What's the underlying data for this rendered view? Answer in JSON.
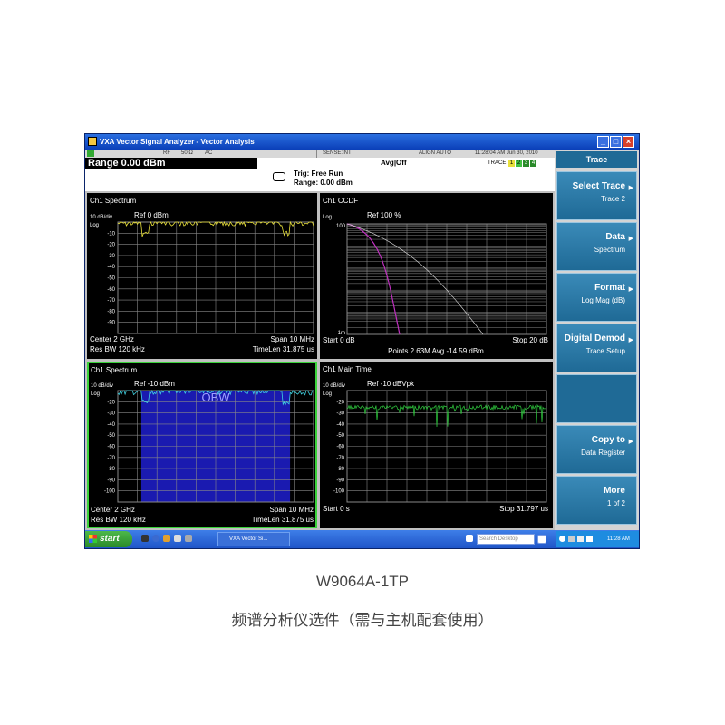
{
  "window": {
    "title": "VXA Vector Signal Analyzer - Vector Analysis",
    "controls": [
      "_",
      "□",
      "×"
    ]
  },
  "statusbar": {
    "items": [
      "RF",
      "50 Ω",
      "AC",
      "SENSE:INT",
      "ALIGN AUTO"
    ],
    "timestamp": "11:28:04 AM Jun 30, 2010",
    "trace_label": "TRACE",
    "trace_numbers": [
      "1",
      "2",
      "3",
      "4"
    ]
  },
  "header": {
    "range": "Range  0.00 dBm",
    "avg": "Avg|Off",
    "trig": "Trig: Free Run",
    "range2": "Range: 0.00 dBm"
  },
  "panels": [
    {
      "title": "Ch1 Spectrum",
      "scale": "10 dB/div",
      "ref": "Ref 0 dBm",
      "log": "Log",
      "yticks": [
        "-10",
        "-20",
        "-30",
        "-40",
        "-50",
        "-60",
        "-70",
        "-80",
        "-90"
      ],
      "bottom_left": "Center 2 GHz",
      "bottom_right": "Span 10 MHz",
      "bottom_left2": "Res BW 120 kHz",
      "bottom_right2": "TimeLen 31.875 us",
      "trace_color": "#e8e03a"
    },
    {
      "title": "Ch1 CCDF",
      "scale": "Log",
      "ref": "Ref 100  %",
      "yticks": [
        "100",
        "1m"
      ],
      "bottom_left": "Start 0 dB",
      "bottom_right": "Stop 20 dB",
      "bottom_center": "Points 2.63M   Avg -14.59 dBm",
      "trace_color": "#c030c0"
    },
    {
      "title": "Ch1 Spectrum",
      "scale": "10 dB/div",
      "ref": "Ref -10 dBm",
      "log": "Log",
      "overlay_label": "OBW",
      "yticks": [
        "-20",
        "-30",
        "-40",
        "-50",
        "-60",
        "-70",
        "-80",
        "-90",
        "-100"
      ],
      "bottom_left": "Center 2 GHz",
      "bottom_right": "Span 10 MHz",
      "bottom_left2": "Res BW 120 kHz",
      "bottom_right2": "TimeLen 31.875 us",
      "trace_color": "#40d0e0",
      "highlight_color": "#1a1ab0"
    },
    {
      "title": "Ch1 Main Time",
      "scale": "10 dB/div",
      "ref": "Ref -10 dBVpk",
      "log": "Log",
      "yticks": [
        "-20",
        "-30",
        "-40",
        "-50",
        "-60",
        "-70",
        "-80",
        "-90",
        "-100"
      ],
      "bottom_left": "Start 0  s",
      "bottom_right": "Stop 31.797 us",
      "trace_color": "#30d040"
    }
  ],
  "sidebar": {
    "title": "Trace",
    "keys": [
      {
        "l1": "Select Trace",
        "l2": "Trace 2",
        "arrow": "▶"
      },
      {
        "l1": "Data",
        "l2": "Spectrum",
        "arrow": "▶"
      },
      {
        "l1": "Format",
        "l2": "Log Mag (dB)",
        "arrow": "▶"
      },
      {
        "l1": "Digital Demod",
        "l2": "Trace Setup",
        "arrow": "▶"
      },
      {
        "l1": "",
        "l2": "",
        "arrow": ""
      },
      {
        "l1": "Copy to",
        "l2": "Data Register",
        "arrow": "▶"
      },
      {
        "l1": "More",
        "l2": "1 of 2",
        "arrow": ""
      }
    ]
  },
  "taskbar": {
    "start": "start",
    "task_button": "VXA Vector Si...",
    "search_placeholder": "Search Desktop",
    "clock": "11:28 AM"
  },
  "captions": {
    "model": "W9064A-1TP",
    "description": "频谱分析仪选件（需与主机配套使用）"
  }
}
